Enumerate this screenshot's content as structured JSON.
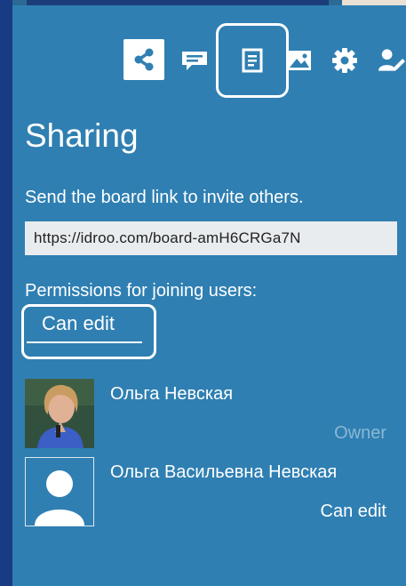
{
  "toolbar": {
    "tools": [
      {
        "name": "share-icon",
        "active": true
      },
      {
        "name": "chat-icon",
        "active": false
      },
      {
        "name": "document-icon",
        "active": false
      },
      {
        "name": "image-icon",
        "active": false
      },
      {
        "name": "gear-icon",
        "active": false
      },
      {
        "name": "user-edit-icon",
        "active": false
      }
    ]
  },
  "sharing": {
    "title": "Sharing",
    "invite_text": "Send the board link to invite others.",
    "board_link": "https://idroo.com/board-amH6CRGa7N",
    "permissions_label": "Permissions for joining users:",
    "permission_value": "Can edit"
  },
  "users": [
    {
      "name": "Ольга Невская",
      "role": "Owner"
    },
    {
      "name": "Ольга Васильевна Невская",
      "role": "Can edit"
    }
  ],
  "colors": {
    "panel_bg": "#2f7fb2",
    "left_border": "#173c84",
    "owner_role": "#8ab8d5",
    "link_field_bg": "#e8ecef"
  }
}
